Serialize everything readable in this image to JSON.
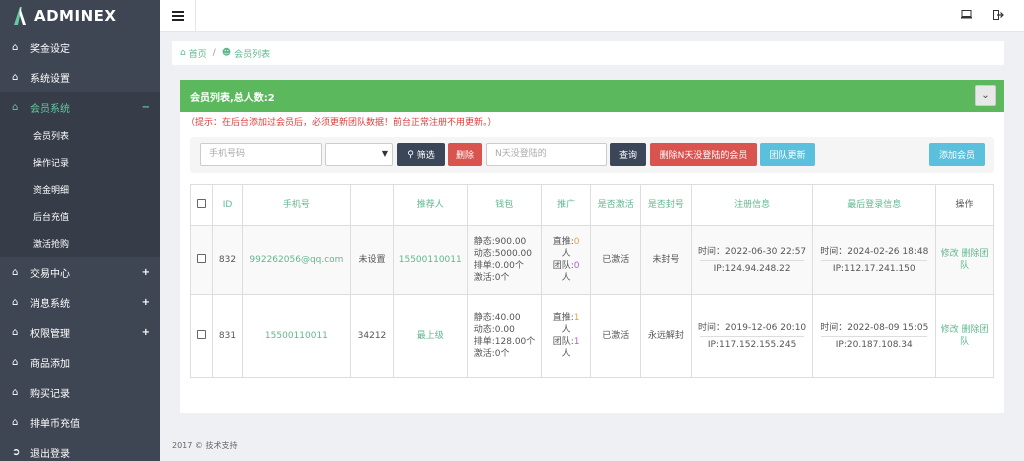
{
  "app": {
    "logo_text": "ADMINEX"
  },
  "sidebar": {
    "items": [
      {
        "label": "奖金设定",
        "icon": "home-icon"
      },
      {
        "label": "系统设置",
        "icon": "home-icon"
      },
      {
        "label": "会员系统",
        "icon": "home-icon",
        "toggle": "−"
      },
      {
        "label": "交易中心",
        "icon": "home-icon",
        "toggle": "+"
      },
      {
        "label": "消息系统",
        "icon": "home-icon",
        "toggle": "+"
      },
      {
        "label": "权限管理",
        "icon": "home-icon",
        "toggle": "+"
      },
      {
        "label": "商品添加",
        "icon": "home-icon"
      },
      {
        "label": "购买记录",
        "icon": "home-icon"
      },
      {
        "label": "排单币充值",
        "icon": "home-icon"
      },
      {
        "label": "退出登录",
        "icon": "sign-out-icon"
      }
    ],
    "sub_items": [
      "会员列表",
      "操作记录",
      "资金明细",
      "后台充值",
      "激活抢购"
    ]
  },
  "breadcrumb": {
    "home": "首页",
    "sep": "/",
    "current": "会员列表"
  },
  "panel": {
    "title": "会员列表,总人数:2",
    "collapse_icon": "chevron-down-icon",
    "hint": "（提示：在后台添加过会员后，必须更新团队数据！前台正常注册不用更新。）"
  },
  "toolbar": {
    "phone_placeholder": "手机号码",
    "select_value": "",
    "filter_label": "筛选",
    "delete_label": "删除",
    "days_placeholder": "N天没登陆的",
    "query_label": "查询",
    "delete_inactive_label": "删除N天没登陆的会员",
    "update_team_label": "团队更新",
    "add_member_label": "添加会员"
  },
  "table": {
    "headers": [
      "",
      "ID",
      "手机号",
      "",
      "推荐人",
      "钱包",
      "推广",
      "是否激活",
      "是否封号",
      "注册信息",
      "最后登录信息",
      "操作"
    ],
    "rows": [
      {
        "id": "832",
        "phone": "992262056@qq.com",
        "name": "未设置",
        "referrer": "15500110011",
        "wallet": [
          "静态:900.00",
          "动态:5000.00",
          "排单:0.00个",
          "激活:0个"
        ],
        "promo_direct_label": "直推:",
        "promo_direct": "0",
        "promo_direct_unit": "人",
        "promo_team_label": "团队:",
        "promo_team": "0",
        "promo_team_unit": "人",
        "activated": "已激活",
        "banned": "未封号",
        "reg_time": "时间：2022-06-30 22:57",
        "reg_ip": "IP:124.94.248.22",
        "login_time": "时间：2024-02-26 18:48",
        "login_ip": "IP:112.17.241.150",
        "op_edit": "修改",
        "op_delete": "删除团队"
      },
      {
        "id": "831",
        "phone": "15500110011",
        "name": "34212",
        "referrer": "最上级",
        "wallet": [
          "静态:40.00",
          "动态:0.00",
          "排单:128.00个",
          "激活:0个"
        ],
        "promo_direct_label": "直推:",
        "promo_direct": "1",
        "promo_direct_unit": "人",
        "promo_team_label": "团队:",
        "promo_team": "1",
        "promo_team_unit": "人",
        "activated": "已激活",
        "banned": "永远解封",
        "reg_time": "时间：2019-12-06 20:10",
        "reg_ip": "IP:117.152.155.245",
        "login_time": "时间：2022-08-09 15:05",
        "login_ip": "IP:20.187.108.34",
        "op_edit": "修改",
        "op_delete": "删除团队"
      }
    ]
  },
  "footer": {
    "text": "2017 © 技术支持"
  },
  "colors": {
    "sidebar": "#3f4653",
    "accent": "#5fb88f",
    "panel_head": "#5cb85c",
    "danger": "#d9534f",
    "info": "#5bc0de",
    "dark_btn": "#3b4658"
  }
}
